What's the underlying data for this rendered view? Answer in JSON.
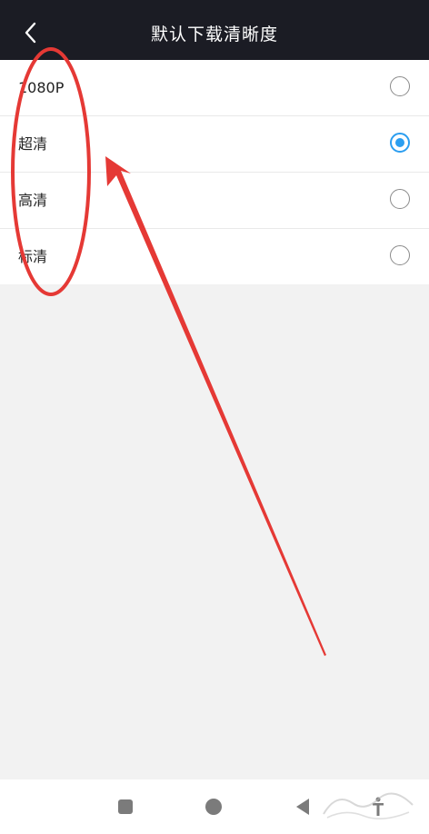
{
  "header": {
    "title": "默认下载清晰度",
    "back_icon": "chevron-left-icon"
  },
  "options": [
    {
      "label": "1080P",
      "selected": false
    },
    {
      "label": "超清",
      "selected": true
    },
    {
      "label": "高清",
      "selected": false
    },
    {
      "label": "标清",
      "selected": false
    }
  ],
  "navbar": {
    "icons": [
      "recent-apps-icon",
      "home-icon",
      "back-icon",
      "accessibility-icon"
    ]
  },
  "colors": {
    "header_bg": "#1b1c24",
    "accent": "#2b9ef0",
    "annotation": "#e53935",
    "background": "#f2f2f2"
  }
}
